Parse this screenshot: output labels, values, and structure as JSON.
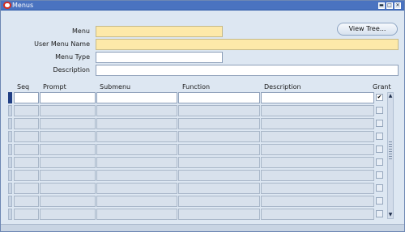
{
  "window": {
    "title": "Menus",
    "minimize_glyph": "▬",
    "maximize_glyph": "□",
    "close_glyph": "✕"
  },
  "header": {
    "menu_label": "Menu",
    "menu_value": "",
    "user_menu_name_label": "User Menu Name",
    "user_menu_name_value": "",
    "menu_type_label": "Menu Type",
    "menu_type_value": "",
    "description_label": "Description",
    "description_value": "",
    "view_tree_label": "View Tree..."
  },
  "table": {
    "columns": [
      "Seq",
      "Prompt",
      "Submenu",
      "Function",
      "Description",
      "Grant"
    ],
    "rows": [
      {
        "seq": "",
        "prompt": "",
        "submenu": "",
        "function": "",
        "description": "",
        "grant": "✔"
      },
      {
        "seq": "",
        "prompt": "",
        "submenu": "",
        "function": "",
        "description": "",
        "grant": ""
      },
      {
        "seq": "",
        "prompt": "",
        "submenu": "",
        "function": "",
        "description": "",
        "grant": ""
      },
      {
        "seq": "",
        "prompt": "",
        "submenu": "",
        "function": "",
        "description": "",
        "grant": ""
      },
      {
        "seq": "",
        "prompt": "",
        "submenu": "",
        "function": "",
        "description": "",
        "grant": ""
      },
      {
        "seq": "",
        "prompt": "",
        "submenu": "",
        "function": "",
        "description": "",
        "grant": ""
      },
      {
        "seq": "",
        "prompt": "",
        "submenu": "",
        "function": "",
        "description": "",
        "grant": ""
      },
      {
        "seq": "",
        "prompt": "",
        "submenu": "",
        "function": "",
        "description": "",
        "grant": ""
      },
      {
        "seq": "",
        "prompt": "",
        "submenu": "",
        "function": "",
        "description": "",
        "grant": ""
      },
      {
        "seq": "",
        "prompt": "",
        "submenu": "",
        "function": "",
        "description": "",
        "grant": ""
      }
    ]
  },
  "scrollbar": {
    "up_glyph": "▲",
    "down_glyph": "▼"
  },
  "colors": {
    "title_bar": "#4a73c0",
    "required_field": "#fde9a9",
    "current_row": "#213f84",
    "background": "#dde7f2"
  }
}
